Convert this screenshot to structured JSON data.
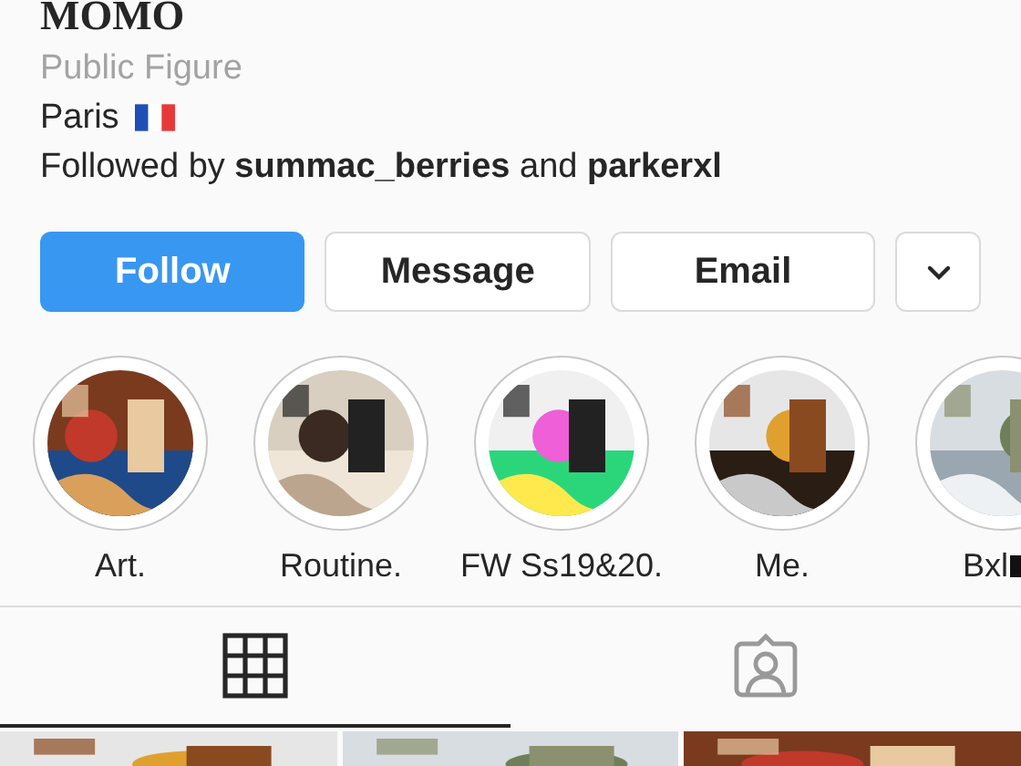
{
  "profile": {
    "name": "MOMO",
    "category": "Public Figure",
    "location": {
      "label": "Paris",
      "kind": "france"
    },
    "followed_by": "Followed by **summac_berries** and **parkerxl**"
  },
  "actions": [
    {
      "label": "Follow",
      "kind": "primary"
    },
    {
      "label": "Message",
      "kind": "secondary"
    },
    {
      "label": "Email",
      "kind": "secondary"
    },
    {
      "kind": "dropdown"
    }
  ],
  "highlights": [
    {
      "label": "Art.",
      "kind": "plain"
    },
    {
      "label": "Routine.",
      "kind": "plain"
    },
    {
      "label": "FW Ss19&20.",
      "kind": "plain"
    },
    {
      "label": "Me.",
      "kind": "plain"
    },
    {
      "label": "Bxl",
      "kind": "belgium"
    }
  ],
  "tabs": [
    {
      "kind": "grid",
      "selected": true
    },
    {
      "kind": "tagged",
      "selected": false
    }
  ]
}
